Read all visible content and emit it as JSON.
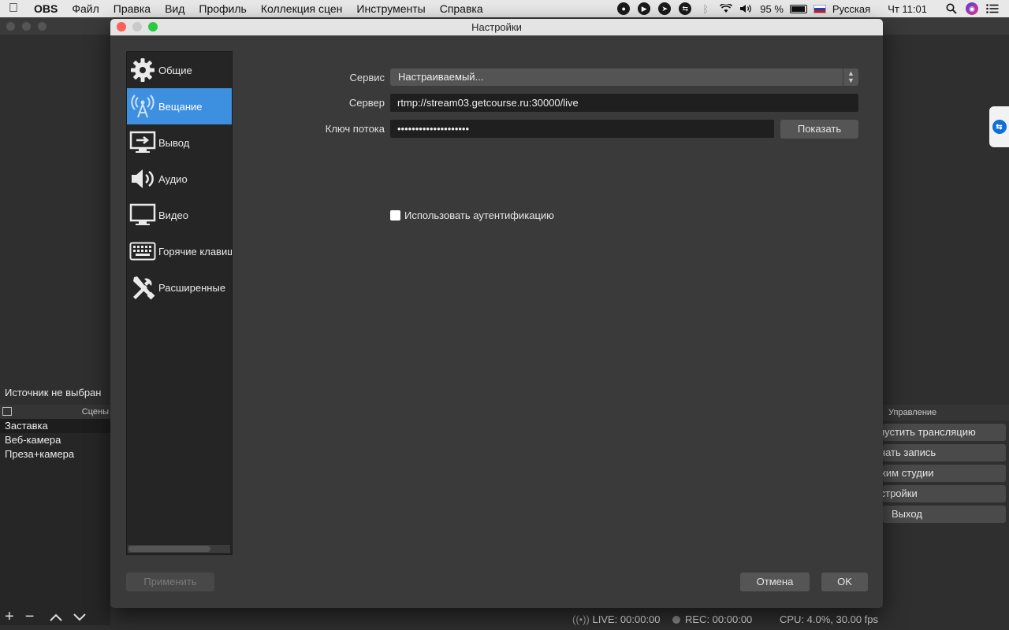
{
  "menubar": {
    "app_name": "OBS",
    "items": [
      "Файл",
      "Правка",
      "Вид",
      "Профиль",
      "Коллекция сцен",
      "Инструменты",
      "Справка"
    ],
    "battery": "95 %",
    "language": "Русская",
    "clock": "Чт 11:01"
  },
  "main": {
    "no_source": "Источник не выбран",
    "scenes_header": "Сцены",
    "scenes": [
      "Заставка",
      "Веб-камера",
      "Преза+камера"
    ],
    "selected_scene_index": 0,
    "controls_header": "Управление",
    "controls": [
      "Запустить трансляцию",
      "Начать запись",
      "Режим студии",
      "Настройки",
      "Выход"
    ],
    "status": {
      "live": "LIVE: 00:00:00",
      "rec": "REC: 00:00:00",
      "cpu": "CPU: 4.0%, 30.00 fps"
    }
  },
  "dialog": {
    "title": "Настройки",
    "nav": [
      {
        "label": "Общие",
        "icon": "gear-icon"
      },
      {
        "label": "Вещание",
        "icon": "broadcast-icon",
        "active": true
      },
      {
        "label": "Вывод",
        "icon": "output-icon"
      },
      {
        "label": "Аудио",
        "icon": "speaker-icon"
      },
      {
        "label": "Видео",
        "icon": "monitor-icon"
      },
      {
        "label": "Горячие клавиши",
        "icon": "keyboard-icon"
      },
      {
        "label": "Расширенные",
        "icon": "tools-icon"
      }
    ],
    "service_label": "Сервис",
    "service_value": "Настраиваемый...",
    "server_label": "Сервер",
    "server_value": "rtmp://stream03.getcourse.ru:30000/live",
    "key_label": "Ключ потока",
    "key_value": "••••••••••••••••••••",
    "show_button": "Показать",
    "auth_label": "Использовать аутентификацию",
    "apply_button": "Применить",
    "cancel_button": "Отмена",
    "ok_button": "OK"
  },
  "colors": {
    "accent": "#3d8fe0",
    "dialog_bg": "#3a3a3a",
    "input_bg": "#1f1f1f"
  }
}
